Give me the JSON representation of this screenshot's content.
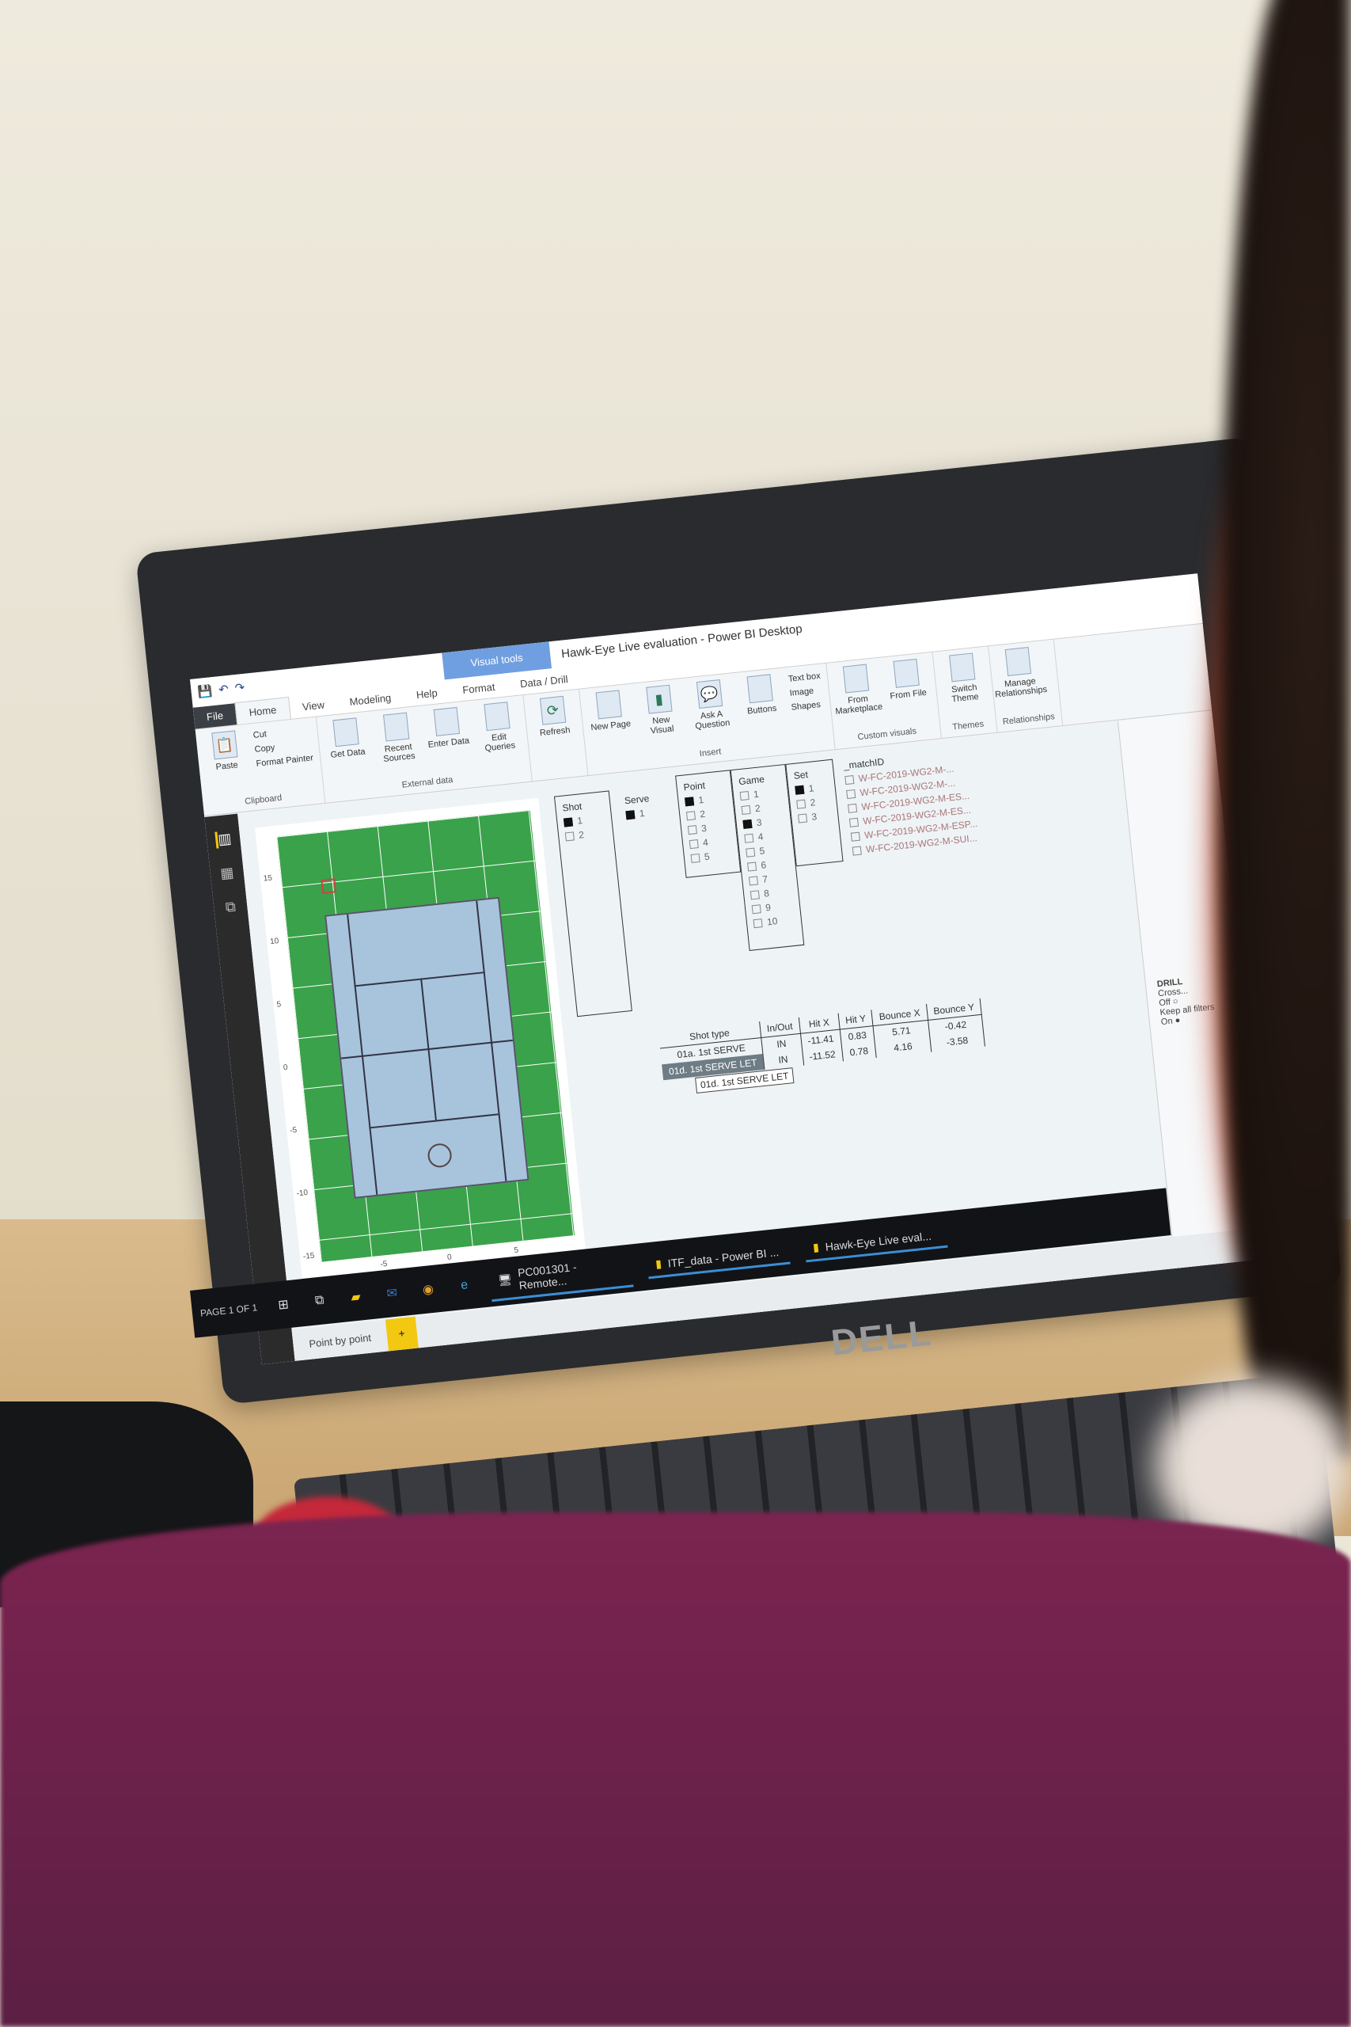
{
  "window": {
    "title": "Hawk-Eye Live evaluation - Power BI Desktop",
    "context_tab": "Visual tools"
  },
  "tabs": [
    "File",
    "Home",
    "View",
    "Modeling",
    "Help",
    "Format",
    "Data / Drill"
  ],
  "ribbon": {
    "clipboard": {
      "paste": "Paste",
      "cut": "Cut",
      "copy": "Copy",
      "format_painter": "Format Painter",
      "label": "Clipboard"
    },
    "external_data": {
      "items": [
        "Get Data",
        "Recent Sources",
        "Enter Data",
        "Edit Queries"
      ],
      "label": "External data"
    },
    "refresh": "Refresh",
    "insert": {
      "items": [
        "New Page",
        "New Visual",
        "Ask A Question",
        "Buttons"
      ],
      "text_box": "Text box",
      "image": "Image",
      "shapes": "Shapes",
      "label": "Insert"
    },
    "custom_visuals": {
      "items": [
        "From Marketplace",
        "From File"
      ],
      "label": "Custom visuals"
    },
    "themes": {
      "items": [
        "Switch Theme"
      ],
      "label": "Themes"
    },
    "relationships": {
      "items": [
        "Manage Relationships"
      ],
      "label": "Relationships"
    }
  },
  "court": {
    "y_ticks": [
      "15",
      "10",
      "5",
      "0",
      "-5",
      "-10",
      "-15"
    ],
    "x_ticks": [
      "-5",
      "0",
      "5"
    ],
    "colors": {
      "surround": "#3aa24a",
      "court": "#a7c4dc"
    }
  },
  "slicers": {
    "shot": {
      "title": "Shot",
      "options": [
        {
          "label": "1",
          "checked": true
        },
        {
          "label": "2",
          "checked": false
        }
      ]
    },
    "serve": {
      "title": "Serve",
      "options": [
        {
          "label": "1",
          "checked": true
        }
      ]
    },
    "point": {
      "title": "Point",
      "options": [
        {
          "label": "1",
          "checked": true
        },
        {
          "label": "2",
          "checked": false
        },
        {
          "label": "3",
          "checked": false
        },
        {
          "label": "4",
          "checked": false
        },
        {
          "label": "5",
          "checked": false
        }
      ]
    },
    "game": {
      "title": "Game",
      "options": [
        {
          "label": "1",
          "checked": false
        },
        {
          "label": "2",
          "checked": false
        },
        {
          "label": "3",
          "checked": true
        },
        {
          "label": "4",
          "checked": false
        },
        {
          "label": "5",
          "checked": false
        },
        {
          "label": "6",
          "checked": false
        },
        {
          "label": "7",
          "checked": false
        },
        {
          "label": "8",
          "checked": false
        },
        {
          "label": "9",
          "checked": false
        },
        {
          "label": "10",
          "checked": false
        }
      ]
    },
    "set": {
      "title": "Set",
      "options": [
        {
          "label": "1",
          "checked": true
        },
        {
          "label": "2",
          "checked": false
        },
        {
          "label": "3",
          "checked": false
        }
      ]
    },
    "match": {
      "title": "_matchID",
      "options": [
        "W-FC-2019-WG2-M-...",
        "W-FC-2019-WG2-M-...",
        "W-FC-2019-WG2-M-ES...",
        "W-FC-2019-WG2-M-ES...",
        "W-FC-2019-WG2-M-ESP...",
        "W-FC-2019-WG2-M-SUI..."
      ]
    }
  },
  "table": {
    "columns": [
      "Shot type",
      "In/Out",
      "Hit X",
      "Hit Y",
      "Bounce X",
      "Bounce Y"
    ],
    "rows": [
      [
        "01a. 1st SERVE",
        "IN",
        "-11.41",
        "0.83",
        "5.71",
        "-0.42"
      ],
      [
        "01d. 1st SERVE LET",
        "IN",
        "-11.52",
        "0.78",
        "4.16",
        "-3.58"
      ]
    ],
    "tooltip": "01d. 1st SERVE LET"
  },
  "right_pane": {
    "heading": "DRILL",
    "cross": "Cross...",
    "off": "Off",
    "keep": "Keep all filters",
    "on": "On"
  },
  "pages": {
    "tab": "Point by point",
    "add": "+",
    "indicator": "PAGE 1 OF 1"
  },
  "taskbar": {
    "apps": [
      "PC001301 - Remote...",
      "ITF_data - Power BI ...",
      "Hawk-Eye Live eval..."
    ]
  },
  "laptop_brand": "DELL"
}
